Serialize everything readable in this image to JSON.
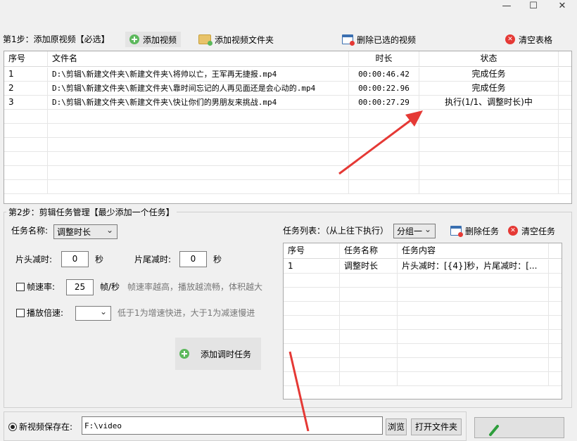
{
  "window": {
    "minimize": "—",
    "maximize": "☐",
    "close": "✕"
  },
  "step1": {
    "title": "第1步：添加原视频【必选】",
    "add_video": "添加视频",
    "add_folder": "添加视频文件夹",
    "delete_selected": "删除已选的视频",
    "clear_table": "清空表格",
    "columns": [
      "序号",
      "文件名",
      "时长",
      "状态"
    ],
    "rows": [
      {
        "no": "1",
        "file": "D:\\剪辑\\新建文件夹\\新建文件夹\\将帅以亡，王军再无捷报.mp4",
        "duration": "00:00:46.42",
        "status": "完成任务"
      },
      {
        "no": "2",
        "file": "D:\\剪辑\\新建文件夹\\新建文件夹\\靠时间忘记的人再见面还是会心动的.mp4",
        "duration": "00:00:22.96",
        "status": "完成任务"
      },
      {
        "no": "3",
        "file": "D:\\剪辑\\新建文件夹\\新建文件夹\\快让你们的男朋友来挑战.mp4",
        "duration": "00:00:27.29",
        "status": "执行(1/1、调整时长)中"
      }
    ]
  },
  "step2": {
    "title": "第2步：剪辑任务管理【最少添加一个任务】",
    "task_name_label": "任务名称:",
    "task_name_value": "调整时长",
    "head_cut_label": "片头减时:",
    "head_cut_value": "0",
    "tail_cut_label": "片尾减时:",
    "tail_cut_value": "0",
    "sec_unit": "秒",
    "frame_rate_label": "帧速率:",
    "frame_rate_value": "25",
    "frame_rate_unit": "帧/秒",
    "frame_rate_hint": "帧速率越高，播放越流畅，体积越大",
    "speed_label": "播放倍速:",
    "speed_value": "",
    "speed_hint": "低于1为增速快进，大于1为减速慢进",
    "add_task": "添加调时任务",
    "task_list_label": "任务列表：（从上往下执行）",
    "group_value": "分组一",
    "delete_task": "删除任务",
    "clear_tasks": "清空任务",
    "task_columns": [
      "序号",
      "任务名称",
      "任务内容"
    ],
    "task_rows": [
      {
        "no": "1",
        "name": "调整时长",
        "content": "片头减时：[{4}]秒，片尾减时：[..."
      }
    ]
  },
  "step3": {
    "save_label": "新视频保存在:",
    "save_path": "F:\\video",
    "browse": "浏览",
    "open_folder": "打开文件夹"
  },
  "colors": {
    "accent_arrow": "#e53935"
  }
}
